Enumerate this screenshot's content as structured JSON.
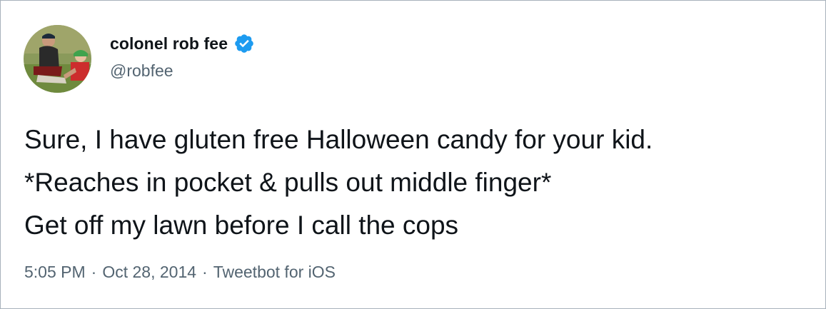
{
  "tweet": {
    "author": {
      "display_name": "colonel rob fee",
      "handle": "@robfee",
      "verified": true,
      "avatar_icon": "profile-photo"
    },
    "text_lines": [
      "Sure, I have gluten free Halloween candy for your kid.",
      "*Reaches in pocket & pulls out middle finger*",
      "Get off my lawn before I call the cops"
    ],
    "meta": {
      "time": "5:05 PM",
      "separator": "·",
      "date": "Oct 28, 2014",
      "source": "Tweetbot for iOS"
    }
  },
  "colors": {
    "text_primary": "#0f1419",
    "text_secondary": "#536471",
    "verified_blue": "#1d9bf0",
    "border": "#a7b1bb"
  }
}
